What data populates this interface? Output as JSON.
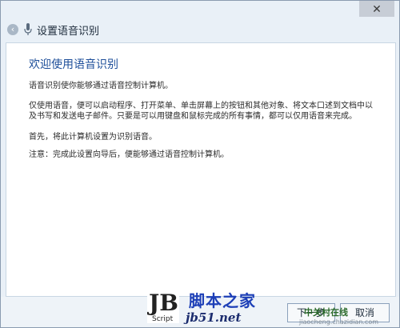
{
  "window": {
    "title": "设置语音识别",
    "close_glyph": "✕",
    "back_glyph": "‹"
  },
  "content": {
    "heading": "欢迎使用语音识别",
    "paragraphs": [
      "语音识别使你能够通过语音控制计算机。",
      "仅使用语音，便可以启动程序、打开菜单、单击屏幕上的按钮和其他对象、将文本口述到文档中以及书写和发送电子邮件。只要是可以用键盘和鼠标完成的所有事情，都可以仅用语音来完成。",
      "首先，将此计算机设置为识别语音。",
      "注意：完成此设置向导后，便能够通过语音控制计算机。"
    ]
  },
  "footer": {
    "next_label": "下一步",
    "cancel_label": "取消"
  },
  "watermark": {
    "logo_text": "JB",
    "logo_sub": "Script",
    "brand": "脚本之家",
    "site": "jb51.net",
    "right_text": "中关村在线",
    "right_url": "jiaocheng.chazidian.com"
  },
  "colors": {
    "heading": "#1e4f9a",
    "window_bg": "#e9f0f7",
    "watermark_brand": "#1d3fb7"
  },
  "icons": {
    "back": "back-arrow-icon",
    "mic": "microphone-icon",
    "close": "close-icon"
  }
}
